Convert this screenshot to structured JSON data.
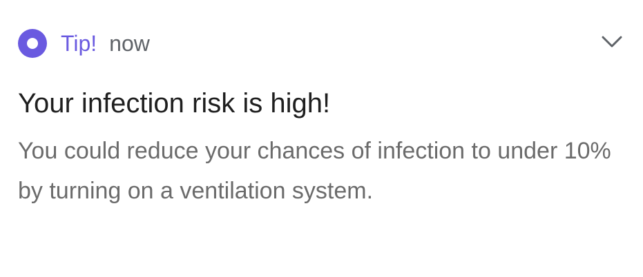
{
  "notification": {
    "app_name": "Tip!",
    "time": "now",
    "title": "Your infection risk is high!",
    "body": "You could reduce your chances of infection to under 10% by turning on a ventilation system.",
    "icon": "app-ring-icon",
    "expand_icon": "chevron-down-icon"
  },
  "colors": {
    "accent": "#6a5ae0",
    "title": "#1f1f1f",
    "body": "#6b6b6b",
    "secondary": "#5f6368"
  }
}
